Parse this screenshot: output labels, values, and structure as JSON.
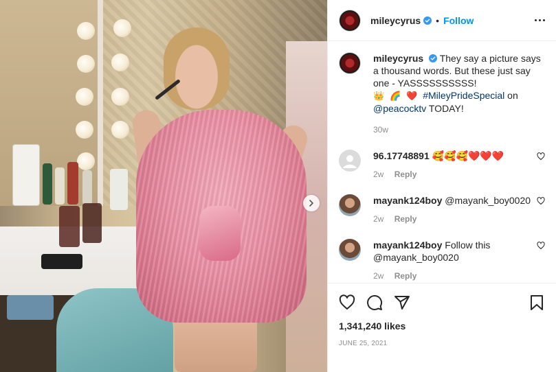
{
  "post": {
    "username": "mileycyrus",
    "follow_label": "Follow",
    "dot": "•",
    "caption": {
      "text_1": "They say a picture says a thousand words. But these just say one - YASSSSSSSSSS!",
      "emoji_crown": "👑",
      "emoji_rainbow": "🌈",
      "emoji_heart": "❤️",
      "hashtag": "#MileyPrideSpecial",
      "on": " on",
      "mention": "@peacocktv",
      "today": " TODAY!",
      "age": "30w"
    },
    "comments": [
      {
        "username": "96.17748891",
        "text": "🥰🥰🥰❤️❤️❤️",
        "age": "2w",
        "reply_label": "Reply"
      },
      {
        "username": "mayank124boy",
        "text": "@mayank_boy0020",
        "age": "2w",
        "reply_label": "Reply"
      },
      {
        "username": "mayank124boy",
        "text": "Follow this @mayank_boy0020",
        "age": "2w",
        "reply_label": "Reply"
      }
    ],
    "likes": "1,341,240 likes",
    "date": "June 25, 2021"
  },
  "colors": {
    "accent": "#0095f6",
    "verified": "#3897f0",
    "muted": "#8e8e8e",
    "text": "#262626"
  },
  "icons": [
    "verified-badge-icon",
    "more-options-icon",
    "heart-icon",
    "comment-icon",
    "share-icon",
    "save-icon",
    "next-arrow-icon",
    "default-avatar-icon"
  ]
}
